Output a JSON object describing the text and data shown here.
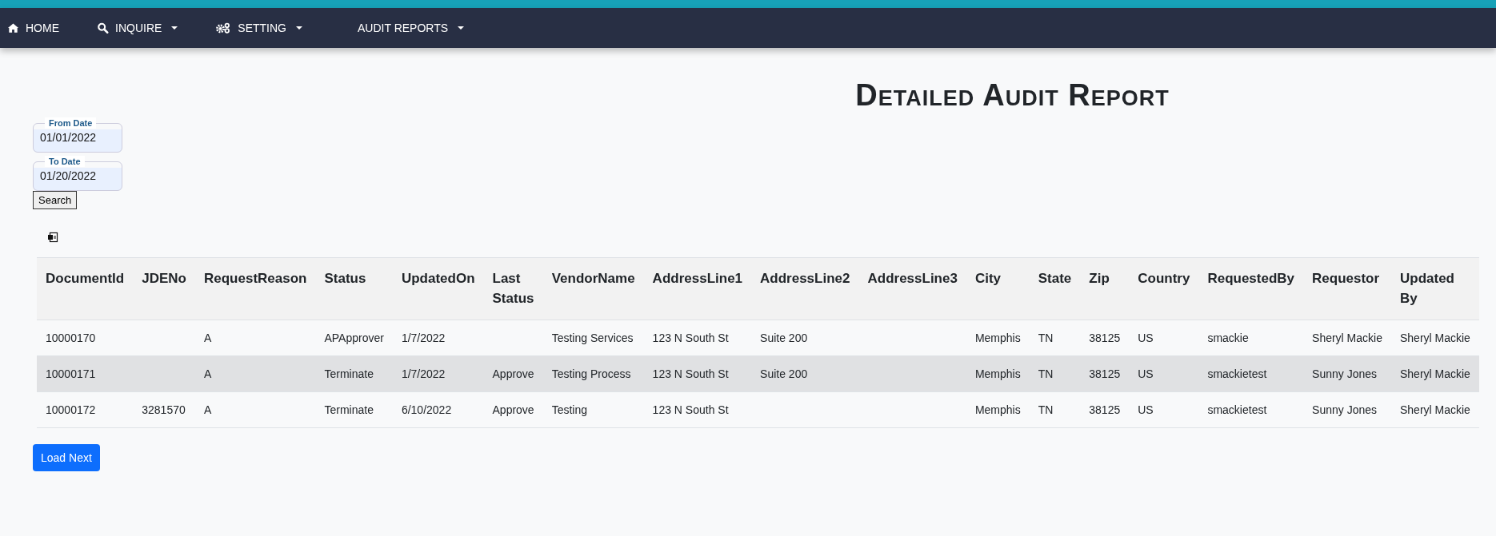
{
  "nav": [
    {
      "label": "HOME",
      "kind": "home",
      "dropdown": false
    },
    {
      "label": "INQUIRE",
      "kind": "search",
      "dropdown": true
    },
    {
      "label": "SETTING",
      "kind": "settings",
      "dropdown": true
    },
    {
      "label": "AUDIT REPORTS",
      "kind": "plain",
      "dropdown": true
    }
  ],
  "title": "Detailed Audit Report",
  "fields": [
    {
      "label": "From Date",
      "value": "01/01/2022"
    },
    {
      "label": "To Date",
      "value": "01/20/2022"
    }
  ],
  "search_button": "Search",
  "table": {
    "columns": [
      "DocumentId",
      "JDENo",
      "RequestReason",
      "Status",
      "UpdatedOn",
      "Last Status",
      "VendorName",
      "AddressLine1",
      "AddressLine2",
      "AddressLine3",
      "City",
      "State",
      "Zip",
      "Country",
      "RequestedBy",
      "Requestor",
      "Updated By"
    ],
    "rows": [
      {
        "selected": false,
        "cells": [
          "10000170",
          "",
          "A",
          "APApprover",
          "1/7/2022",
          "",
          "Testing Services",
          "123 N South St",
          "Suite 200",
          "",
          "Memphis",
          "TN",
          "38125",
          "US",
          "smackie",
          "Sheryl Mackie",
          "Sheryl Mackie"
        ]
      },
      {
        "selected": true,
        "cells": [
          "10000171",
          "",
          "A",
          "Terminate",
          "1/7/2022",
          "Approve",
          "Testing Process",
          "123 N South St",
          "Suite 200",
          "",
          "Memphis",
          "TN",
          "38125",
          "US",
          "smackietest",
          "Sunny Jones",
          "Sheryl Mackie"
        ]
      },
      {
        "selected": false,
        "cells": [
          "10000172",
          "3281570",
          "A",
          "Terminate",
          "6/10/2022",
          "Approve",
          "Testing",
          "123 N South St",
          "",
          "",
          "Memphis",
          "TN",
          "38125",
          "US",
          "smackietest",
          "Sunny Jones",
          "Sheryl Mackie"
        ]
      }
    ]
  },
  "load_button": "Load Next"
}
